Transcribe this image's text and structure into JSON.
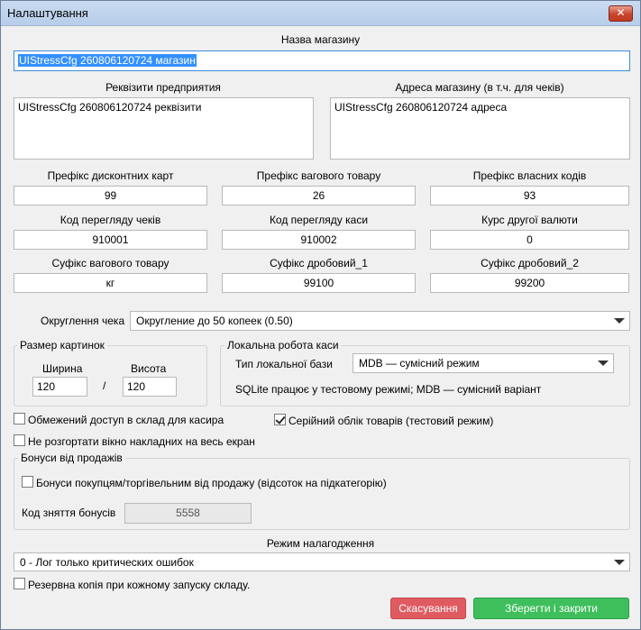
{
  "window": {
    "title": "Налаштування",
    "close_glyph": "✕"
  },
  "store_name": {
    "label": "Назва магазину",
    "value": "UIStressCfg 260806120724 магазин"
  },
  "requisites": {
    "label": "Реквізити предприятия",
    "value": "UIStressCfg 260806120724 реквізити"
  },
  "store_address": {
    "label": "Адреса магазину (в т.ч. для чеків)",
    "value": "UIStressCfg 260806120724 адреса"
  },
  "fields": {
    "discount_prefix": {
      "label": "Префікс дисконтних карт",
      "value": "99"
    },
    "weight_prefix": {
      "label": "Префікс вагового товару",
      "value": "26"
    },
    "own_codes_prefix": {
      "label": "Префікс власних кодів",
      "value": "93"
    },
    "receipt_view_code": {
      "label": "Код перегляду чеків",
      "value": "910001"
    },
    "register_view_code": {
      "label": "Код перегляду каси",
      "value": "910002"
    },
    "second_currency_rate": {
      "label": "Курс другої валюти",
      "value": "0"
    },
    "weight_suffix": {
      "label": "Суфікс вагового товару",
      "value": "кг"
    },
    "fraction_suffix_1": {
      "label": "Суфікс дробовий_1",
      "value": "99100"
    },
    "fraction_suffix_2": {
      "label": "Суфікс дробовий_2",
      "value": "99200"
    }
  },
  "rounding": {
    "label": "Округлення чека",
    "value": "Округление до 50 копеек (0.50)"
  },
  "image_size": {
    "group_title": "Размер картинок",
    "width_label": "Ширина",
    "width_value": "120",
    "separator": "/",
    "height_label": "Висота",
    "height_value": "120"
  },
  "local_register": {
    "group_title": "Локальна робота каси",
    "db_type_label": "Тип локальної бази",
    "db_type_value": "MDB — сумісний режим",
    "note": "SQLite працює у тестовому режимі; MDB — сумісний варіант"
  },
  "checkboxes": {
    "restricted_access": {
      "label": "Обмежений доступ в склад для касира",
      "checked": false
    },
    "serial_tracking": {
      "label": "Серійний облік товарів (тестовий режим)",
      "checked": true
    },
    "no_maximize": {
      "label": "Не розгортати вікно накладних на весь екран",
      "checked": false
    },
    "backup": {
      "label": "Резервна копія при кожному запуску складу.",
      "checked": false
    }
  },
  "bonuses": {
    "group_title": "Бонуси від продажів",
    "checkbox_label": "Бонуси покупцям/торгівельним від продажу (відсоток на підкатегорію)",
    "checkbox_checked": false,
    "code_label": "Код зняття бонусів",
    "code_value": "5558"
  },
  "debug_mode": {
    "label": "Режим налагодження",
    "value": "0 - Лог только критических ошибок"
  },
  "buttons": {
    "cancel": "Скасування",
    "save": "Зберегти і закрити"
  },
  "colors": {
    "cancel": "#e05b61",
    "save": "#3fbf5c",
    "selection": "#3390ff"
  }
}
